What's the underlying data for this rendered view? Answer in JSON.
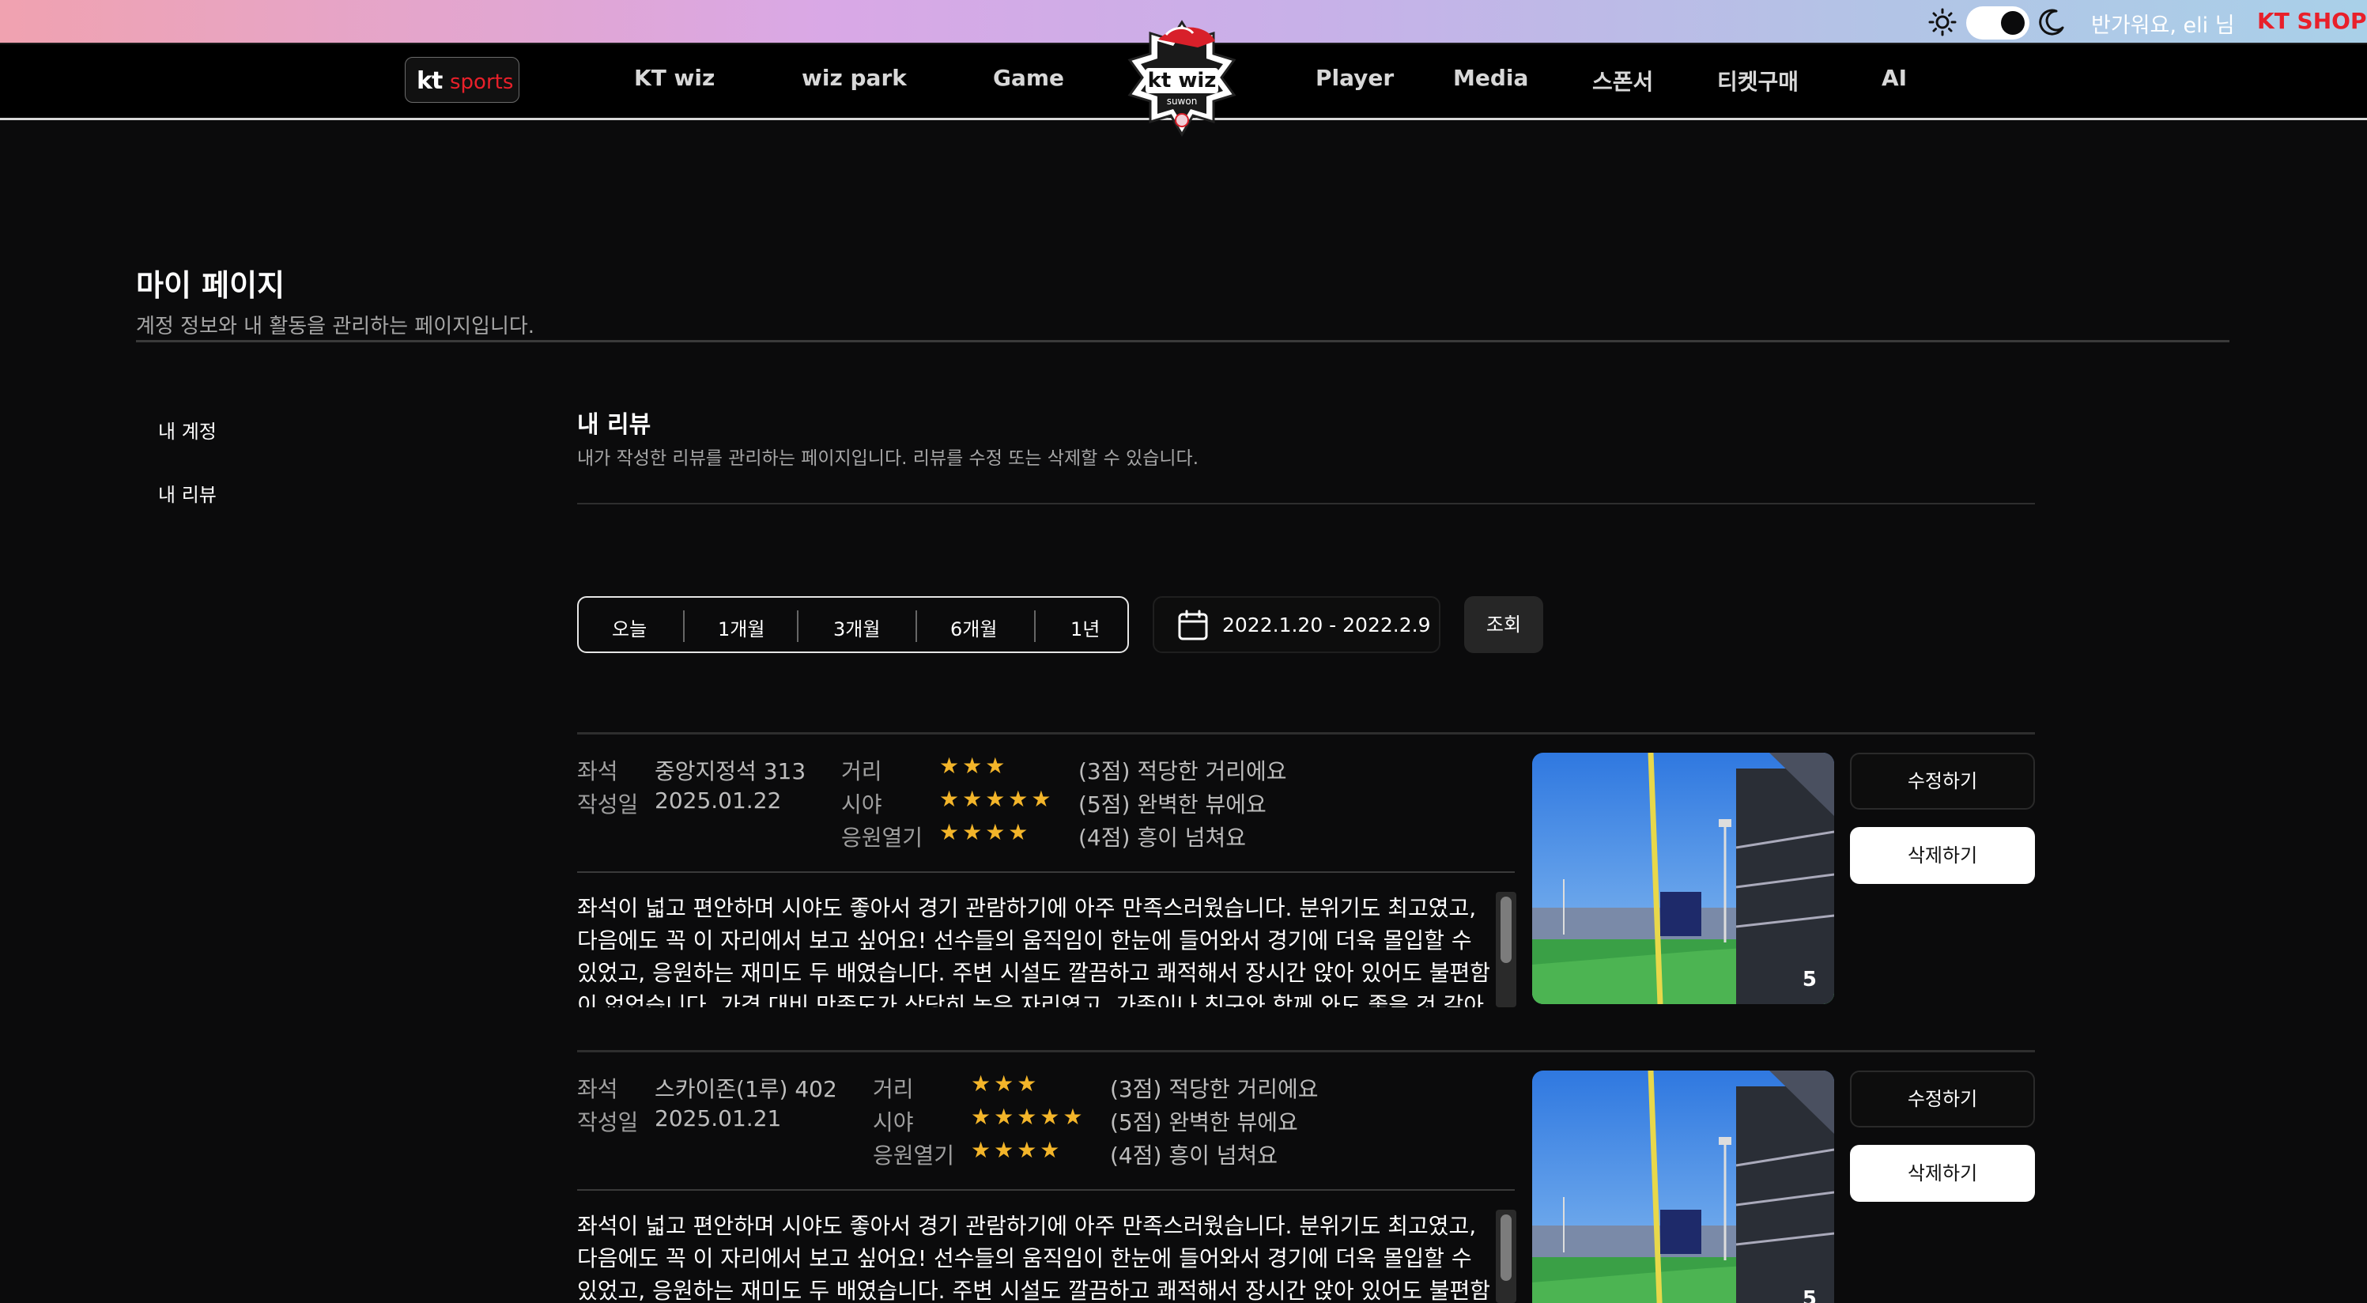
{
  "topbar": {
    "greeting": "반가워요, eli 님",
    "shop_label": "KT SHOP",
    "theme_toggle": "dark"
  },
  "nav": {
    "logo_kt": "kt",
    "logo_sports": "sports",
    "items": [
      "KT wiz",
      "wiz park",
      "Game",
      "Player",
      "Media",
      "스폰서",
      "티켓구매",
      "AI"
    ]
  },
  "page": {
    "title": "마이 페이지",
    "subtitle": "계정 정보와 내 활동을 관리하는 페이지입니다."
  },
  "sidebar": {
    "items": [
      "내 계정",
      "내 리뷰"
    ]
  },
  "section": {
    "title": "내 리뷰",
    "subtitle": "내가 작성한 리뷰를 관리하는 페이지입니다. 리뷰를 수정 또는 삭제할 수 있습니다."
  },
  "filter": {
    "periods": [
      "오늘",
      "1개월",
      "3개월",
      "6개월",
      "1년"
    ],
    "date_range": "2022.1.20 - 2022.2.9",
    "search_label": "조회"
  },
  "labels": {
    "seat": "좌석",
    "date": "작성일",
    "distance": "거리",
    "view": "시야",
    "cheer": "응원열기",
    "edit": "수정하기",
    "delete": "삭제하기"
  },
  "reviews": [
    {
      "seat": "중앙지정석 313",
      "date": "2025.01.22",
      "distance_stars": "★★★",
      "distance_text": "(3점) 적당한 거리에요",
      "view_stars": "★★★★★",
      "view_text": "(5점) 완벽한 뷰에요",
      "cheer_stars": "★★★★",
      "cheer_text": "(4점) 흥이 넘쳐요",
      "body": "좌석이 넓고 편안하며 시야도 좋아서 경기 관람하기에 아주 만족스러웠습니다. 분위기도 최고였고, 다음에도 꼭 이 자리에서 보고 싶어요! 선수들의 움직임이 한눈에 들어와서 경기에 더욱 몰입할 수 있었고, 응원하는 재미도 두 배였습니다. 주변 시설도 깔끔하고 쾌적해서 장시간 앉아 있어도 불편함이 없었습니다. 가격 대비 만족도가 상당히 높은 자리였고, 가족이나 친구와 함께 와도 좋을 것 같아요. 다음번에도",
      "photo_count": "5"
    },
    {
      "seat": "스카이존(1루) 402",
      "date": "2025.01.21",
      "distance_stars": "★★★",
      "distance_text": "(3점) 적당한 거리에요",
      "view_stars": "★★★★★",
      "view_text": "(5점) 완벽한 뷰에요",
      "cheer_stars": "★★★★",
      "cheer_text": "(4점) 흥이 넘쳐요",
      "body": "좌석이 넓고 편안하며 시야도 좋아서 경기 관람하기에 아주 만족스러웠습니다. 분위기도 최고였고, 다음에도 꼭 이 자리에서 보고 싶어요! 선수들의 움직임이 한눈에 들어와서 경기에 더욱 몰입할 수 있었고, 응원하는 재미도 두 배였습니다. 주변 시설도 깔끔하고 쾌적해서 장시간 앉아 있어도 불편함이 없었습니다.",
      "photo_count": "5"
    }
  ]
}
